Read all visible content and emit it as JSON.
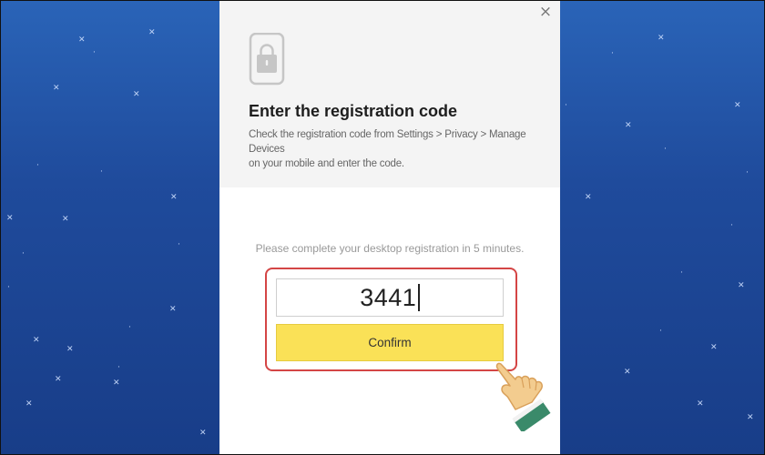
{
  "dialog": {
    "title": "Enter the registration code",
    "description_lines": [
      "Check the registration code from Settings > Privacy > Manage",
      "Devices",
      "on your mobile and enter the code."
    ],
    "notice": "Please complete your desktop registration in 5 minutes.",
    "code_value": "3441",
    "confirm_label": "Confirm",
    "close_symbol": "×"
  },
  "icons": {
    "header_icon": "phone-lock-icon",
    "close": "close-icon",
    "pointer": "hand-pointer-icon"
  },
  "colors": {
    "confirm_button": "#fae157",
    "highlight_border": "#d44545",
    "background_blue": "#1f4b9c",
    "header_background": "#f4f4f4"
  }
}
